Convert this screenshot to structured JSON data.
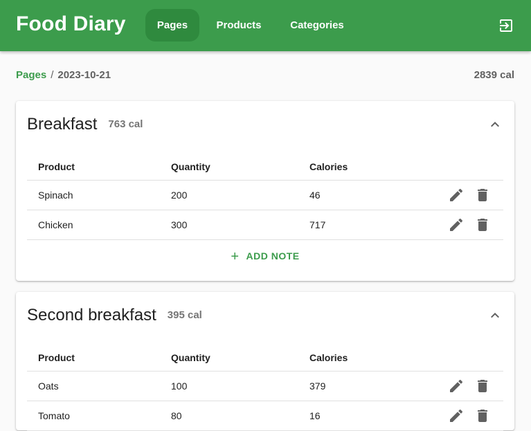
{
  "app": {
    "title": "Food Diary",
    "nav": [
      {
        "label": "Pages",
        "active": true
      },
      {
        "label": "Products",
        "active": false
      },
      {
        "label": "Categories",
        "active": false
      }
    ],
    "logout_icon": "logout-icon"
  },
  "breadcrumb": {
    "root": "Pages",
    "separator": "/",
    "current": "2023-10-21"
  },
  "page_total": "2839 cal",
  "columns": {
    "product": "Product",
    "quantity": "Quantity",
    "calories": "Calories"
  },
  "meals": [
    {
      "name": "Breakfast",
      "calories": "763 cal",
      "rows": [
        {
          "product": "Spinach",
          "quantity": "200",
          "calories": "46"
        },
        {
          "product": "Chicken",
          "quantity": "300",
          "calories": "717"
        }
      ],
      "add_note": "ADD NOTE"
    },
    {
      "name": "Second breakfast",
      "calories": "395 cal",
      "rows": [
        {
          "product": "Oats",
          "quantity": "100",
          "calories": "379"
        },
        {
          "product": "Tomato",
          "quantity": "80",
          "calories": "16"
        }
      ]
    }
  ],
  "colors": {
    "primary": "#3c9c4c",
    "primary_dark": "#2f8a3e"
  }
}
